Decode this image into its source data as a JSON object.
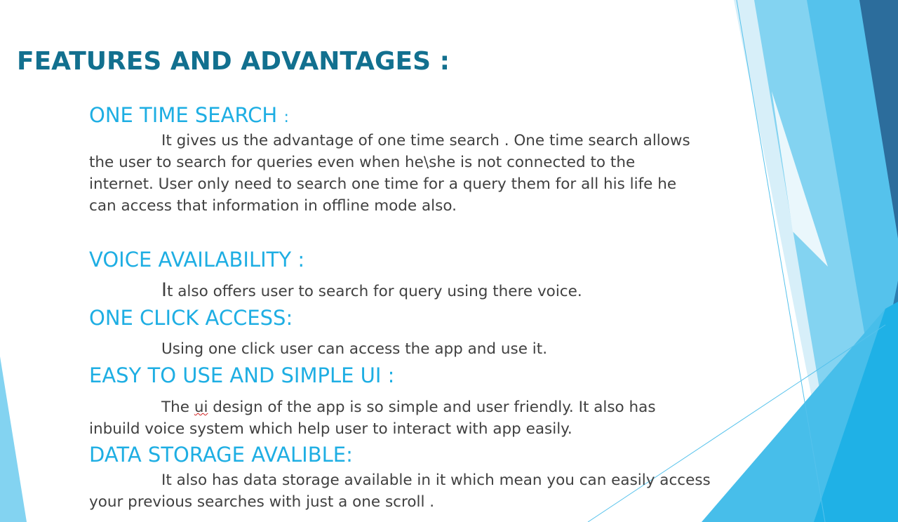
{
  "slide": {
    "title": "FEATURES AND ADVANTAGES :",
    "sections": [
      {
        "heading": "ONE TIME SEARCH",
        "heading_suffix": ":",
        "lines": [
          "It gives us the advantage of one time search . One time search allows",
          "the user to search for queries even when he\\she is not connected to the",
          "internet. User only need to search one time for a query them for all his life he",
          "can access that information in offline mode also."
        ]
      },
      {
        "heading": "VOICE AVAILABILITY :",
        "first_letter": "I",
        "lines": [
          "t also offers user to search for query using there voice."
        ]
      },
      {
        "heading": "ONE CLICK ACCESS:",
        "lines": [
          "Using one click user can access the app and use it."
        ]
      },
      {
        "heading": "EASY TO USE AND SIMPLE UI :",
        "line1_prefix": "The ",
        "line1_flagged": "ui",
        "line1_rest": " design of the app is so simple and user friendly. It also has",
        "lines": [
          "inbuild voice system which help user to interact with app easily."
        ]
      },
      {
        "heading": "DATA STORAGE AVALIBLE:",
        "lines": [
          "It also has data storage available in it which mean you can easily access",
          "your previous searches with just a one scroll ."
        ]
      }
    ]
  },
  "theme": {
    "title_color": "#12708f",
    "heading_color": "#1eaee3",
    "body_color": "#404040",
    "accent_dark": "#2c6d9c",
    "accent_mid": "#1fb1e6",
    "accent_light": "#83d3f1"
  }
}
